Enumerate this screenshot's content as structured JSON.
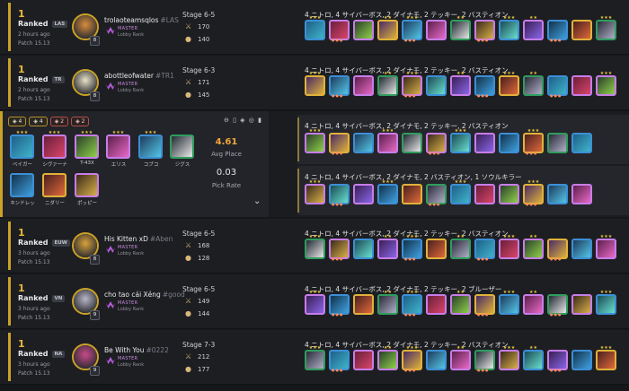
{
  "matches": [
    {
      "place": "1",
      "queue": "Ranked",
      "region": "LAS",
      "time": "2 hours ago",
      "patch": "Patch 15.13",
      "name": "trolaoteamsqlos",
      "tag": "#LAS",
      "level": "8",
      "rank": "MASTER",
      "lobby": "Lobby Rank",
      "stage": "Stage 6-5",
      "damage": "170",
      "gold": "140",
      "traits": "4 ニトロ, 4 サイバーボス, 2 ダイナモ, 2 テッキー, 2 バスティオン",
      "avatar_color": "#d98c3b"
    },
    {
      "place": "1",
      "queue": "Ranked",
      "region": "TR",
      "time": "2 hours ago",
      "patch": "Patch 15.13",
      "name": "abottleofwater",
      "tag": "#TR1",
      "level": "8",
      "rank": "MASTER",
      "lobby": "Lobby Rank",
      "stage": "Stage 6-3",
      "damage": "171",
      "gold": "145",
      "traits": "4 ニトロ, 4 サイバーボス, 2 ダイナモ, 2 テッキー, 2 バスティオン",
      "avatar_color": "#e9e3c8"
    },
    {
      "place": "1",
      "queue": "Ranked",
      "region": "EUW",
      "time": "3 hours ago",
      "patch": "Patch 15.13",
      "name": "His Kitten xD",
      "tag": "#Aben",
      "level": "8",
      "rank": "MASTER",
      "lobby": "Lobby Rank",
      "stage": "Stage 6-5",
      "damage": "168",
      "gold": "128",
      "traits": "4 ニトロ, 4 サイバーボス, 2 ダイナモ, 2 テッキー, 2 バスティオン",
      "avatar_color": "#d9a23a"
    },
    {
      "place": "1",
      "queue": "Ranked",
      "region": "VN",
      "time": "3 hours ago",
      "patch": "Patch 15.13",
      "name": "cho tao cái Xẻng",
      "tag": "#good",
      "level": "9",
      "rank": "MASTER",
      "lobby": "Lobby Rank",
      "stage": "Stage 6-5",
      "damage": "149",
      "gold": "144",
      "traits": "4 ニトロ, 4 サイバーボス, 2 ダイナモ, 2 テッキー, 2 ブルーザー",
      "avatar_color": "#b9b7c8"
    },
    {
      "place": "1",
      "queue": "Ranked",
      "region": "NA",
      "time": "3 hours ago",
      "patch": "Patch 15.13",
      "name": "Be With You",
      "tag": "#0222",
      "level": "9",
      "rank": "MASTER",
      "lobby": "Lobby Rank",
      "stage": "Stage 7-3",
      "damage": "212",
      "gold": "177",
      "traits": "4 ニトロ, 4 サイバーボス, 2 ダイナモ, 2 テッキー, 2 バスティオン",
      "avatar_color": "#c94a8a"
    }
  ],
  "comp": {
    "chips": [
      "4",
      "4",
      "2",
      "2"
    ],
    "tools": "⊖ ▯ ◈ ◎ ▮",
    "units": [
      "ベイガー",
      "シヴァーナ",
      "T-43X",
      "エリス",
      "コブコ",
      "ジグス",
      "キンドレッ",
      "ニダリー",
      "ポッピー"
    ],
    "avg_place": "4.61",
    "avg_label": "Avg Place",
    "pick_rate": "0.03",
    "pick_label": "Pick Rate",
    "sub_traits": [
      "4 ニトロ, 4 サイバーボス, 2 ダイナモ, 2 テッキー, 2 バスティオン",
      "4 ニトロ, 4 サイバーボス, 2 ダイナモ, 2 バスティオン, 1 ソウルキラー"
    ]
  },
  "colors": {
    "gold": "#c9a227",
    "background": "#16171b",
    "avg": "#f0a43a"
  }
}
